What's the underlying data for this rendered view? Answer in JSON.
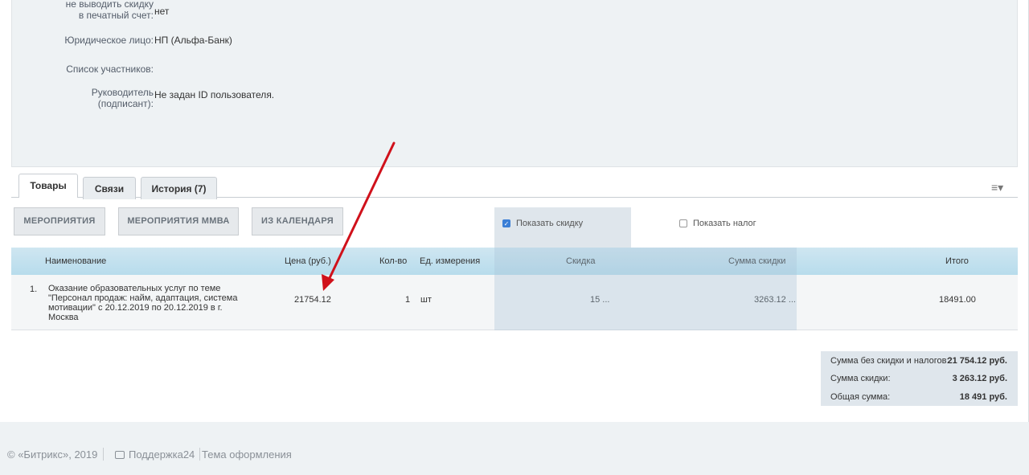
{
  "info": {
    "discount_label": "не выводить скидку в печатный счет:",
    "discount_value": "нет",
    "legal_label": "Юридическое лицо:",
    "legal_value": "НП (Альфа-Банк)",
    "participants_label": "Список участников:",
    "manager_label": "Руководитель (подписант):",
    "manager_value": "Не задан ID пользователя."
  },
  "tabs": [
    {
      "label": "Товары",
      "active": true
    },
    {
      "label": "Связи",
      "active": false
    },
    {
      "label": "История (7)",
      "active": false
    }
  ],
  "menu_icon": "hamburger-menu-icon",
  "buttons": {
    "events": "МЕРОПРИЯТИЯ",
    "events_mmva": "МЕРОПРИЯТИЯ ММВА",
    "from_calendar": "ИЗ КАЛЕНДАРЯ"
  },
  "options": {
    "show_discount": {
      "label": "Показать скидку",
      "checked": true
    },
    "show_tax": {
      "label": "Показать налог",
      "checked": false
    }
  },
  "table": {
    "headers": {
      "name": "Наименование",
      "price": "Цена (руб.)",
      "qty": "Кол-во",
      "unit": "Ед. измерения",
      "discount": "Скидка",
      "discount_sum": "Сумма скидки",
      "total": "Итого"
    },
    "rows": [
      {
        "num": "1.",
        "name_lines": [
          "Оказание образовательных услуг по теме",
          "\"Персонал продаж: найм, адаптация, система",
          "мотивации\" с 20.12.2019 по 20.12.2019 в г.",
          "Москва"
        ],
        "price": "21754.12",
        "qty": "1",
        "unit": "шт",
        "discount": "15 ...",
        "discount_sum": "3263.12 ...",
        "total": "18491.00"
      }
    ]
  },
  "totals": {
    "without_label": "Сумма без скидки и налогов:",
    "without_value": "21 754.12 руб.",
    "discount_label": "Сумма скидки:",
    "discount_value": "3 263.12 руб.",
    "total_label": "Общая сумма:",
    "total_value": "18 491 руб."
  },
  "footer": {
    "copyright": "© «Битрикс», 2019",
    "support": "Поддержка24",
    "theme": "Тема оформления"
  },
  "colors": {
    "arrow": "#d0111b",
    "checkbox_on": "#3b7fd6",
    "header_bg": "#b7dcec"
  }
}
